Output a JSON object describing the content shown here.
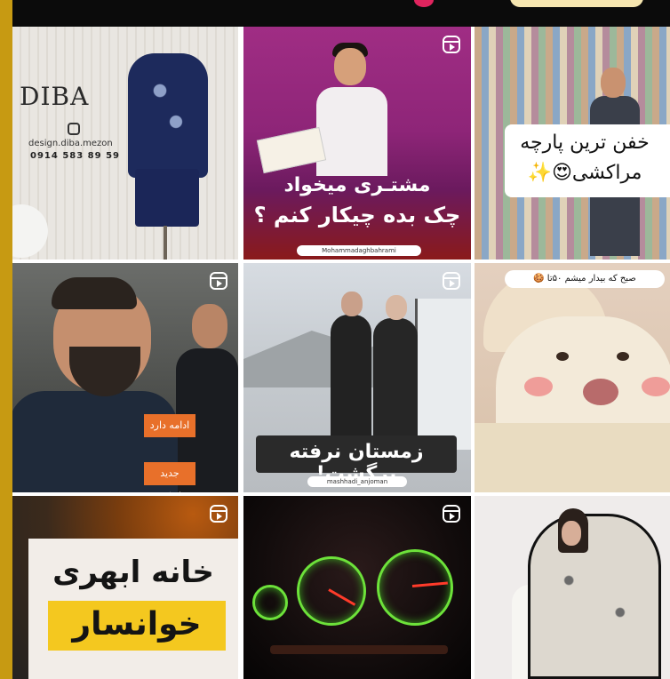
{
  "grid": {
    "tiles": [
      {
        "id": "diba",
        "brand": "DIBA",
        "handle": "design.diba.mezon",
        "phone": "0914 583 89 59"
      },
      {
        "id": "cheque",
        "caption_line1": "مشتـری میخواد",
        "caption_line2": "چک بده چیکار کنم ؟",
        "footer": "Mohammadaghbahrami"
      },
      {
        "id": "fabrics",
        "caption_line1": "خفن ترین پارچه",
        "caption_line2": "مراکشی😍✨"
      },
      {
        "id": "man-street",
        "tag1": "ادامه دارد",
        "tag2": "جدید وانعکس"
      },
      {
        "id": "snow",
        "caption": "زمستان نرفته برگشت!",
        "footer": "mashhadi_anjoman"
      },
      {
        "id": "dog",
        "label": "صبح که بیدار میشم ۵۰تا 🍪"
      },
      {
        "id": "khansar",
        "caption_line1": "خانه ابهری",
        "caption_line2": "خوانسار"
      },
      {
        "id": "dashboard"
      },
      {
        "id": "shawl"
      }
    ]
  }
}
